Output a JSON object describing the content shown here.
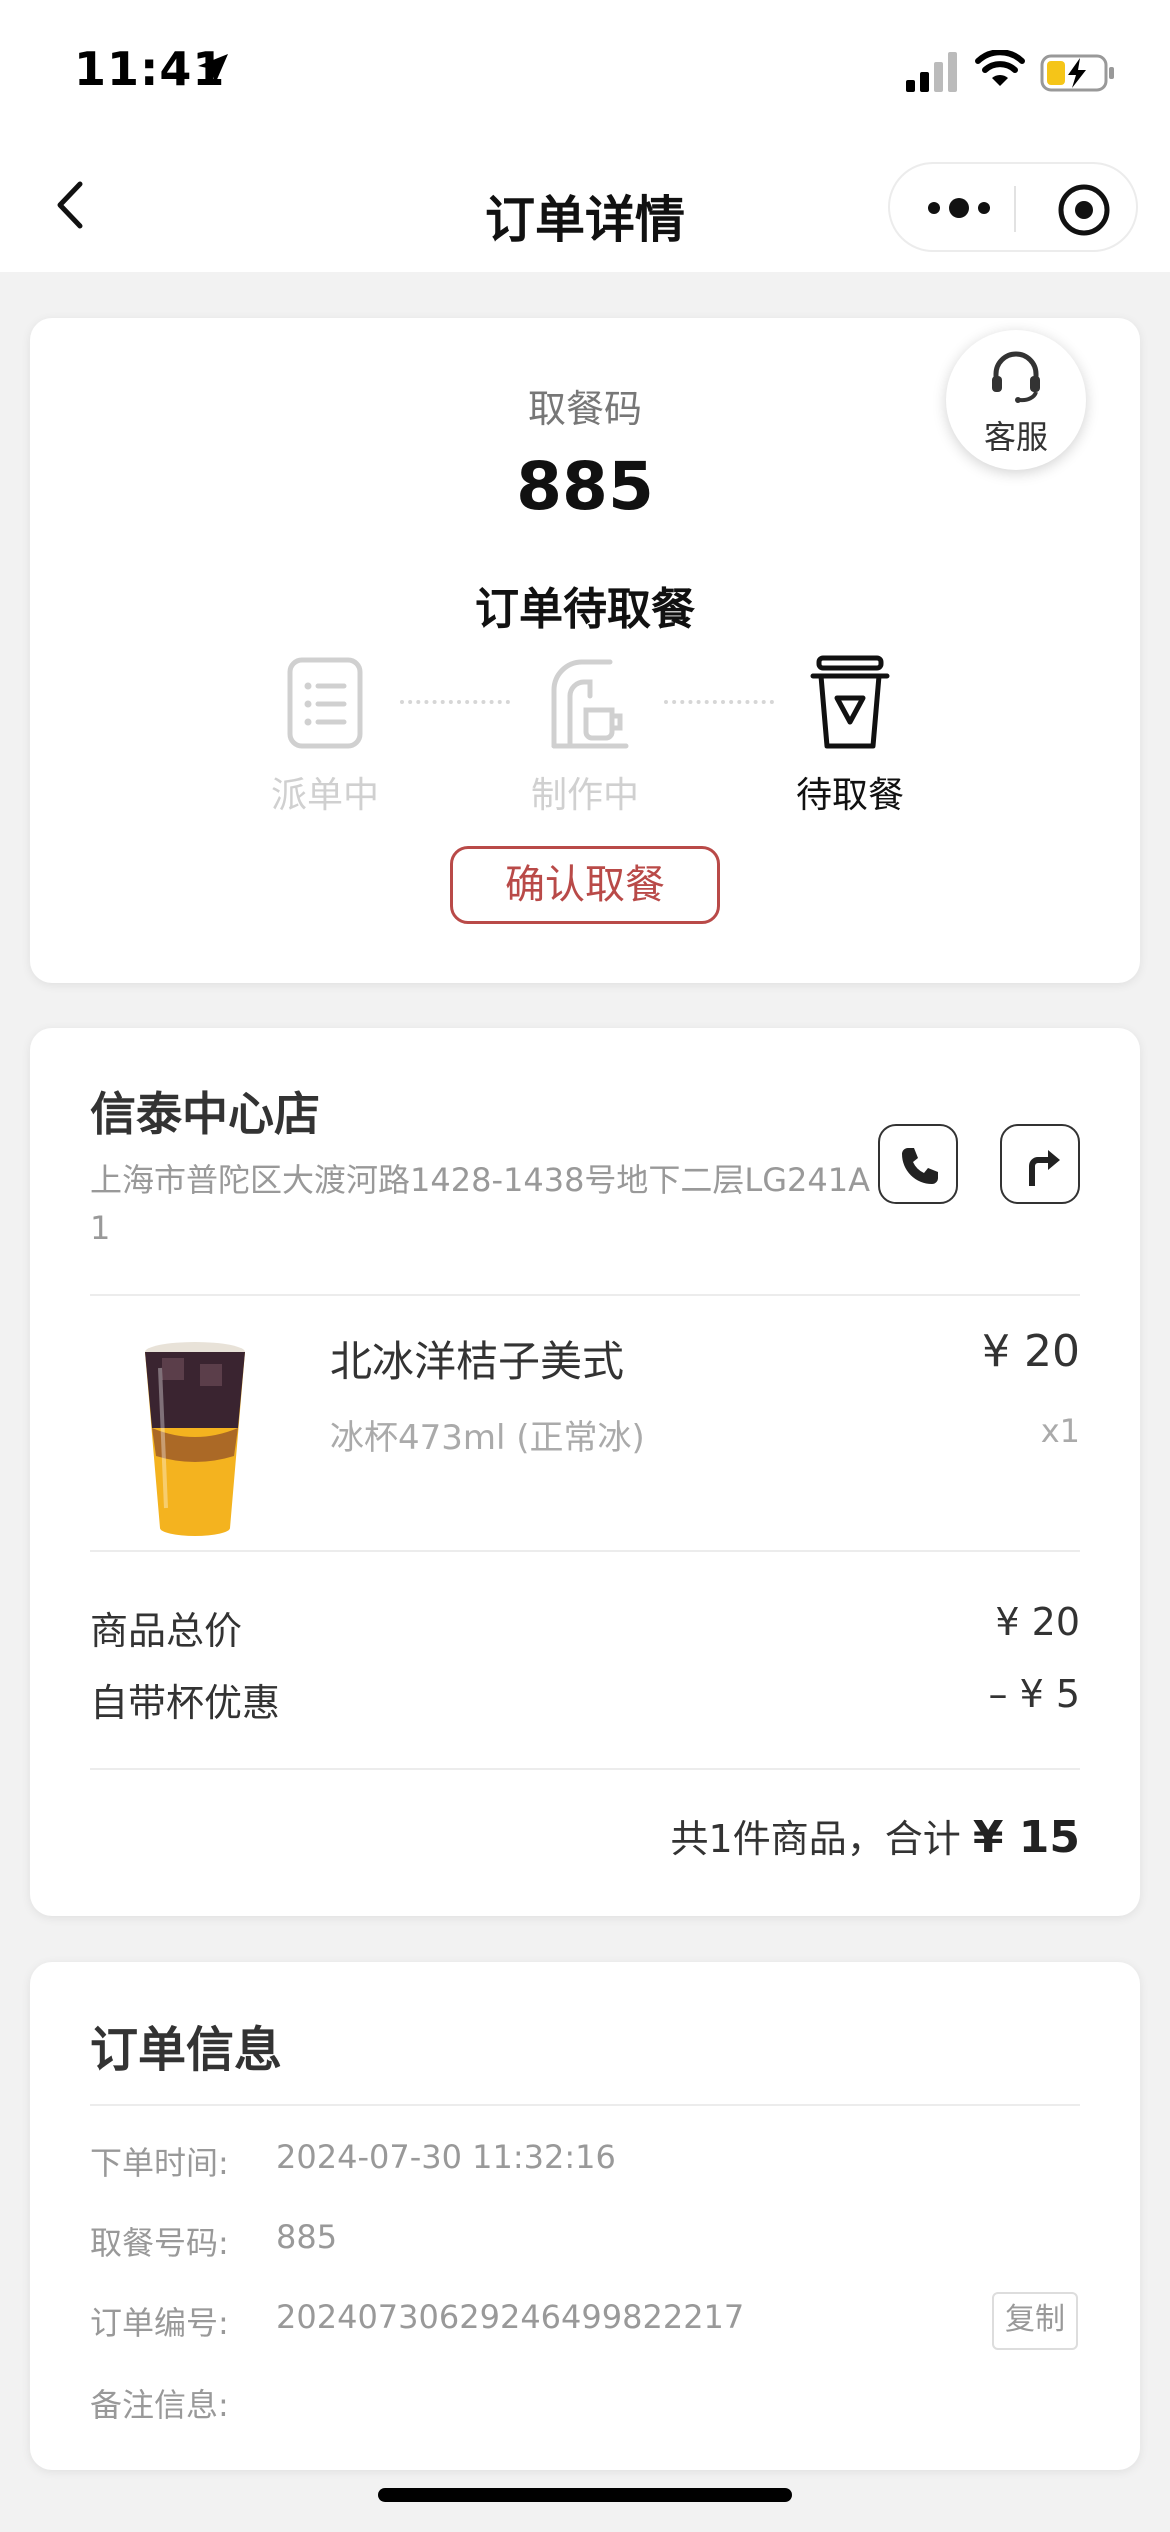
{
  "status_bar": {
    "time": "11:41"
  },
  "nav": {
    "title": "订单详情"
  },
  "customer_service": {
    "label": "客服"
  },
  "pickup": {
    "label": "取餐码",
    "code": "885",
    "status": "订单待取餐",
    "steps": [
      {
        "label": "派单中",
        "state": "done"
      },
      {
        "label": "制作中",
        "state": "done"
      },
      {
        "label": "待取餐",
        "state": "active"
      }
    ],
    "confirm_label": "确认取餐"
  },
  "store": {
    "name": "信泰中心店",
    "address": "上海市普陀区大渡河路1428-1438号地下二层LG241A1"
  },
  "product": {
    "name": "北冰洋桔子美式",
    "spec": "冰杯473ml (正常冰)",
    "price": "¥ 20",
    "qty": "x1"
  },
  "fees": {
    "subtotal_label": "商品总价",
    "subtotal_value": "¥ 20",
    "discount_label": "自带杯优惠",
    "discount_value": "– ¥ 5",
    "total_text": "共1件商品，合计",
    "total_amount": "¥ 15"
  },
  "order_info": {
    "title": "订单信息",
    "time_label": "下单时间:",
    "time_value": "2024-07-30 11:32:16",
    "code_label": "取餐号码:",
    "code_value": "885",
    "id_label": "订单编号:",
    "id_value": "20240730629246499822217",
    "copy_label": "复制",
    "remark_label": "备注信息:"
  },
  "colors": {
    "accent": "#b94a48",
    "muted": "#999999",
    "inactive_step": "#d0d0d0"
  },
  "icons": [
    "location-arrow-icon",
    "signal-icon",
    "wifi-icon",
    "battery-charging-icon",
    "back-icon",
    "more-icon",
    "close-target-icon",
    "headset-icon",
    "order-list-icon",
    "coffee-machine-icon",
    "takeaway-cup-icon",
    "phone-icon",
    "directions-icon"
  ]
}
